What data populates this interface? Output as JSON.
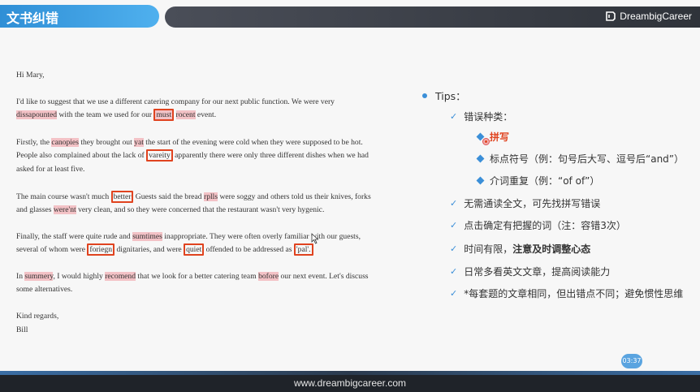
{
  "header": {
    "title": "文书纠错",
    "brand": "DreambigCareer"
  },
  "letter": {
    "greeting": "Hi Mary,",
    "p1": {
      "l1": "I'd like to suggest that we use a different catering company for our next public function. We were very",
      "l2_err1": "dissapounted",
      "l2_a": " with the team we used for our ",
      "l2_box1": "must",
      "l2_sp": " ",
      "l2_err2": "rocent",
      "l2_b": " event."
    },
    "p2": {
      "l1_a": "Firstly, the ",
      "l1_err1": "canopies",
      "l1_b": " they brought out ",
      "l1_err2": "yat",
      "l1_c": " the start of the evening were cold when they were supposed to be hot.",
      "l2_a": "People also complained about the lack of ",
      "l2_box1": "vareity",
      "l2_b": " apparently there were only three different dishes when we had",
      "l3": "asked for at least five."
    },
    "p3": {
      "l1_a": "The main course wasn't much ",
      "l1_box1": "better",
      "l1_b": " Guests said the bread ",
      "l1_err1": "rplls",
      "l1_c": " were soggy and others told us their knives, forks",
      "l2_a": "and glasses ",
      "l2_err1": "were'nt",
      "l2_b": " very clean, and so they were concerned that the restaurant wasn't very hygenic."
    },
    "p4": {
      "l1_a": "Finally, the staff were quite rude and ",
      "l1_err1": "sumtimes",
      "l1_b": " inappropriate. They were often overly familiar with our guests,",
      "l2_a": "several of whom were ",
      "l2_box1": "foriegn",
      "l2_b": " dignitaries, and were ",
      "l2_box2": "quiet",
      "l2_c": " offended to be addressed as ",
      "l2_box3": "'pal'."
    },
    "p5": {
      "l1_a": "In ",
      "l1_err1": "summery",
      "l1_b": ", I would highly ",
      "l1_err2": "recomend",
      "l1_c": " that we look for a better catering team ",
      "l1_err3": "bofore",
      "l1_d": " our next event. Let's discuss",
      "l2": "some alternatives."
    },
    "closing": "Kind regards,",
    "signature": "Bill"
  },
  "tips": {
    "heading": "Tips：",
    "error_types": "错误种类：",
    "spelling": "拼写",
    "punctuation": "标点符号（例：句号后大写、逗号后“and”）",
    "preposition": "介词重复（例：“of of”）",
    "no_full_read": "无需通读全文，可先找拼写错误",
    "click_confirm": "点击确定有把握的词（注：容错3次）",
    "time_a": "时间有限，",
    "time_b": "注意及时调整心态",
    "read_more": "日常多看英文文章，提高阅读能力",
    "note": "*每套题的文章相同，但出错点不同；避免惯性思维"
  },
  "player": {
    "time_badge": "03:37"
  },
  "footer": {
    "url": "www.dreambigcareer.com"
  },
  "colors": {
    "accent": "#3b8fd8",
    "error_box": "#e0431f",
    "highlight": "#f3c2c6"
  }
}
